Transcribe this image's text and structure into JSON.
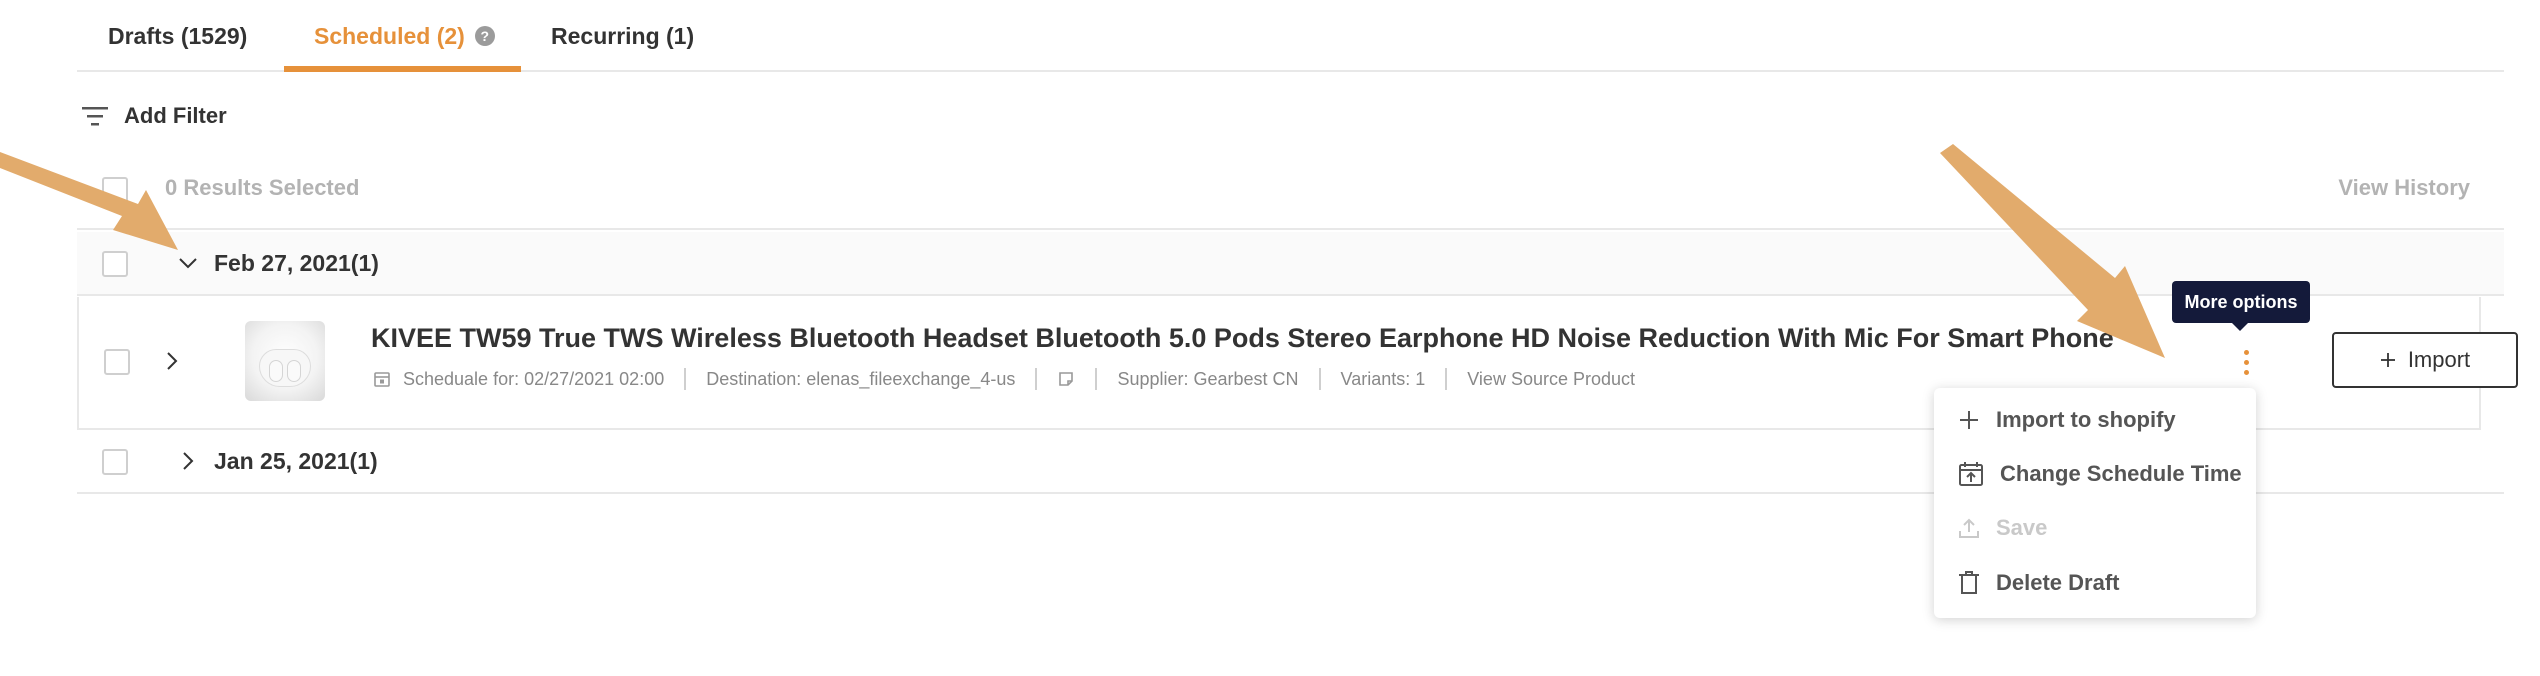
{
  "tabs": [
    {
      "label": "Drafts (1529)",
      "active": false
    },
    {
      "label": "Scheduled (2)",
      "active": true,
      "help_icon": "?"
    },
    {
      "label": "Recurring (1)",
      "active": false
    }
  ],
  "filter": {
    "label": "Add Filter",
    "icon": "filter-lines-icon"
  },
  "results": {
    "selected_text": "0 Results Selected",
    "view_history": "View History"
  },
  "groups": [
    {
      "date": "Feb 27, 2021(1)",
      "expanded": true
    },
    {
      "date": "Jan 25, 2021(1)",
      "expanded": false
    }
  ],
  "product": {
    "title": "KIVEE TW59 True TWS Wireless Bluetooth Headset Bluetooth 5.0 Pods Stereo Earphone HD Noise Reduction With Mic For Smart Phone",
    "schedule": "Scheduale for: 02/27/2021 02:00",
    "destination": "Destination: elenas_fileexchange_4-us",
    "supplier": "Supplier: Gearbest CN",
    "variants": "Variants: 1",
    "source_link": "View Source Product",
    "import_label": "Import"
  },
  "tooltip": "More options",
  "menu": [
    {
      "label": "Import to shopify",
      "icon": "plus-icon",
      "disabled": false
    },
    {
      "label": "Change Schedule Time",
      "icon": "calendar-clock-icon",
      "disabled": false
    },
    {
      "label": "Save",
      "icon": "upload-icon",
      "disabled": true
    },
    {
      "label": "Delete Draft",
      "icon": "trash-icon",
      "disabled": false
    }
  ],
  "colors": {
    "accent": "#e6913a",
    "tooltip_bg": "#141a3a",
    "arrow": "#e2ab6c",
    "text": "#333333",
    "muted": "#b3b3b3"
  }
}
